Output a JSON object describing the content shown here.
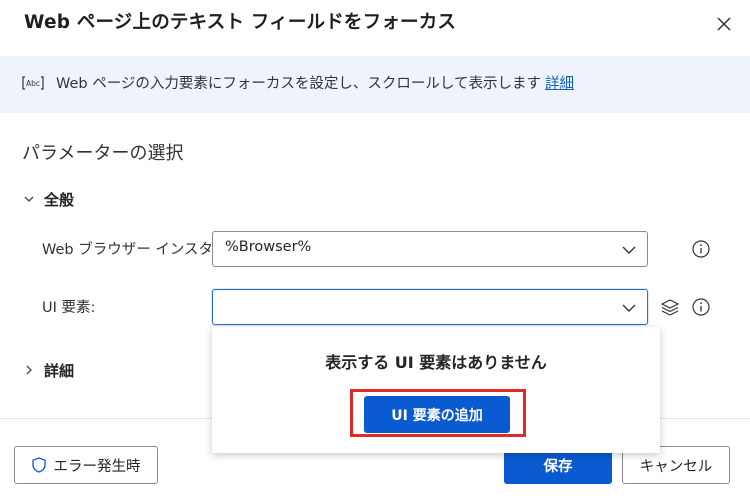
{
  "dialog": {
    "title": "Web ページ上のテキスト フィールドをフォーカス"
  },
  "banner": {
    "text": "Web ページの入力要素にフォーカスを設定し、スクロールして表示します",
    "link": "詳細",
    "icon": "text-field-icon"
  },
  "section": {
    "title": "パラメーターの選択"
  },
  "general": {
    "header": "全般",
    "browser_label": "Web ブラウザー インスタンス:",
    "browser_value": "%Browser%",
    "ui_label": "UI 要素:",
    "ui_value": ""
  },
  "details": {
    "header": "詳細"
  },
  "dropdown": {
    "empty_message": "表示する UI 要素はありません",
    "add_button": "UI 要素の追加"
  },
  "footer": {
    "error_button": "エラー発生時",
    "save_button": "保存",
    "cancel_button": "キャンセル"
  },
  "colors": {
    "accent": "#0a5ad1",
    "banner_bg": "#eff4fc",
    "highlight": "#e02a2a",
    "link": "#0f62c2"
  }
}
